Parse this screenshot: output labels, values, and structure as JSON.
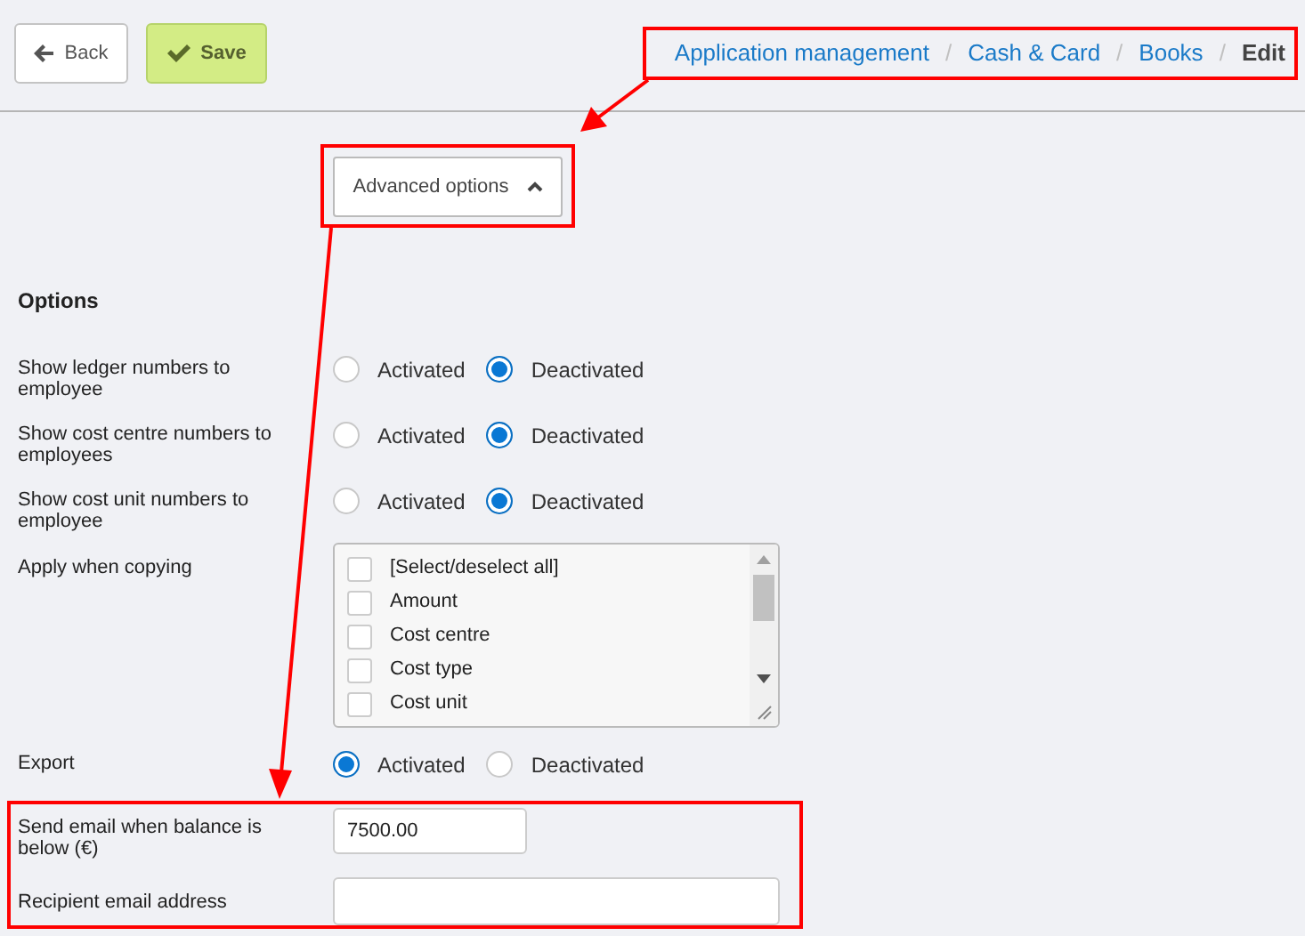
{
  "toolbar": {
    "back": "Back",
    "save": "Save"
  },
  "breadcrumb": {
    "separator": "/",
    "items": [
      {
        "label": "Application management",
        "current": false
      },
      {
        "label": "Cash & Card",
        "current": false
      },
      {
        "label": "Books",
        "current": false
      },
      {
        "label": "Edit",
        "current": true
      }
    ]
  },
  "advanced_options": {
    "label": "Advanced options",
    "expanded": true
  },
  "section_title": "Options",
  "settings": [
    {
      "kind": "radio",
      "label": "Show ledger numbers to employee",
      "options": [
        {
          "label": "Activated",
          "selected": false
        },
        {
          "label": "Deactivated",
          "selected": true
        }
      ]
    },
    {
      "kind": "radio",
      "label": "Show cost centre numbers to employees",
      "options": [
        {
          "label": "Activated",
          "selected": false
        },
        {
          "label": "Deactivated",
          "selected": true
        }
      ]
    },
    {
      "kind": "radio",
      "label": "Show cost unit numbers to employee",
      "options": [
        {
          "label": "Activated",
          "selected": false
        },
        {
          "label": "Deactivated",
          "selected": true
        }
      ]
    },
    {
      "kind": "checklist",
      "label": "Apply when copying",
      "items": [
        {
          "label": "[Select/deselect all]",
          "checked": false
        },
        {
          "label": "Amount",
          "checked": false
        },
        {
          "label": "Cost centre",
          "checked": false
        },
        {
          "label": "Cost type",
          "checked": false
        },
        {
          "label": "Cost unit",
          "checked": false
        }
      ]
    },
    {
      "kind": "radio",
      "label": "Export",
      "options": [
        {
          "label": "Activated",
          "selected": true
        },
        {
          "label": "Deactivated",
          "selected": false
        }
      ]
    },
    {
      "kind": "number-field",
      "label": "Send email when balance is below (€)",
      "value": "7500.00"
    },
    {
      "kind": "text-field",
      "label": "Recipient email address"
    }
  ]
}
